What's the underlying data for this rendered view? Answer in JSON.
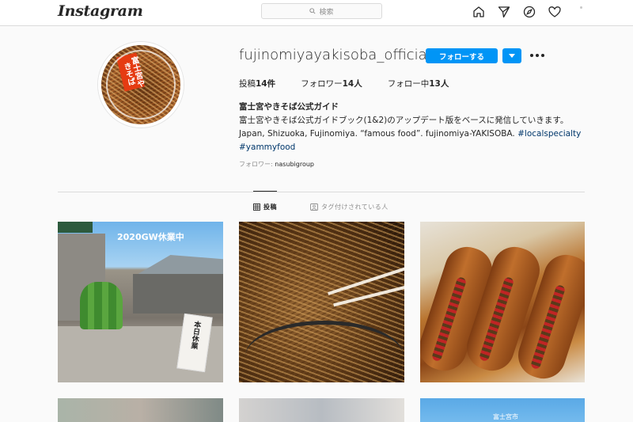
{
  "app": {
    "logo": "Instagram",
    "search_placeholder": "検索"
  },
  "profile": {
    "username": "fujinomiyayakisoba_official",
    "follow_label": "フォローする",
    "avatar_label": "富士宮やきそば",
    "stats": {
      "posts_label": "投稿",
      "posts_count": "14件",
      "followers_label": "フォロワー",
      "followers_count": "14人",
      "following_label": "フォロー中",
      "following_count": "13人"
    },
    "bio": {
      "name": "富士宮やきそば公式ガイド",
      "line1": "富士宮やきそば公式ガイドブック(1&2)のアップデート版をベースに発信していきます。",
      "line2_text": "Japan, Shizuoka, Fujinomiya. “famous food”. fujinomiya-YAKISOBA.",
      "hashtag1": "#localspecialty",
      "hashtag2": "#yammyfood"
    },
    "followed_by_label": "フォロワー:",
    "followed_by_user": "nasubigroup"
  },
  "tabs": {
    "posts": "投稿",
    "tagged": "タグ付けされている人"
  },
  "posts": {
    "p1_caption": "2020GW休業中",
    "p1_sign": "本日休業",
    "p6_text": "富士宮市"
  },
  "colors": {
    "accent": "#0095f6",
    "link": "#00376b",
    "border": "#dbdbdb",
    "background": "#fafafa"
  }
}
